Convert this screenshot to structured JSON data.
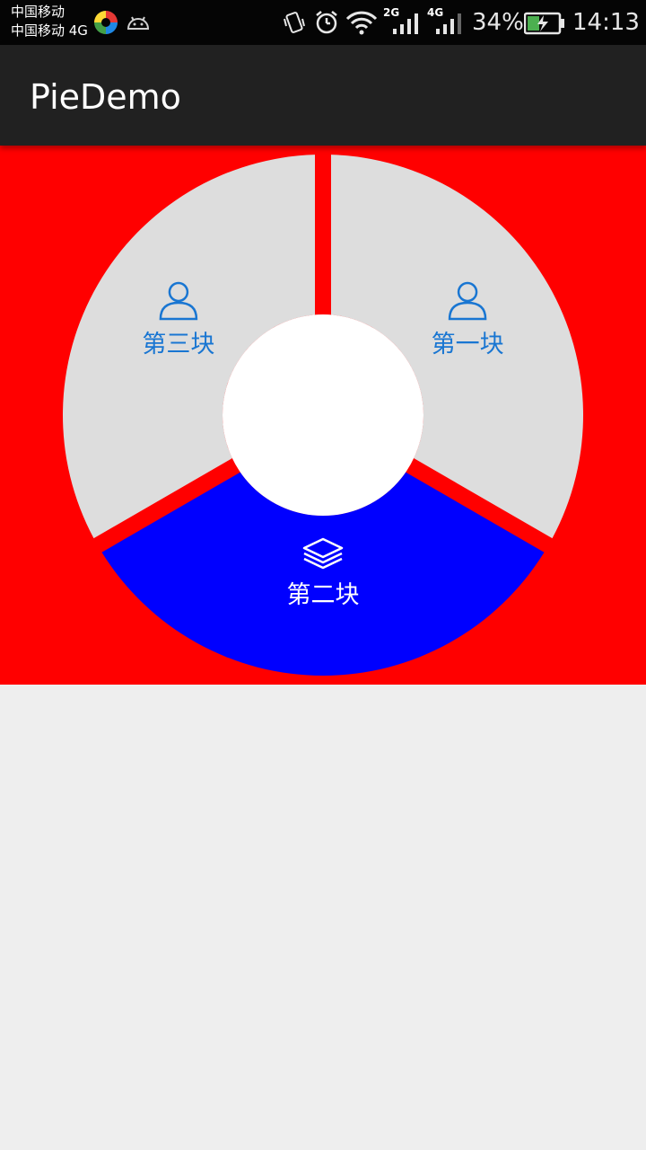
{
  "status_bar": {
    "carrier_1": "中国移动",
    "carrier_2": "中国移动 4G",
    "network_2g": "2G",
    "network_4g": "4G",
    "battery": "34%",
    "time": "14:13"
  },
  "app_bar": {
    "title": "PieDemo"
  },
  "pie": {
    "background_color": "#ff0000",
    "center_color": "#ffffff",
    "slices": [
      {
        "label": "第一块",
        "icon": "user-icon",
        "fill": "#dddddd",
        "text_color": "#1976d2",
        "selected": false
      },
      {
        "label": "第二块",
        "icon": "layers-icon",
        "fill": "#0000ff",
        "text_color": "#ffffff",
        "selected": true
      },
      {
        "label": "第三块",
        "icon": "user-icon",
        "fill": "#dddddd",
        "text_color": "#1976d2",
        "selected": false
      }
    ]
  }
}
